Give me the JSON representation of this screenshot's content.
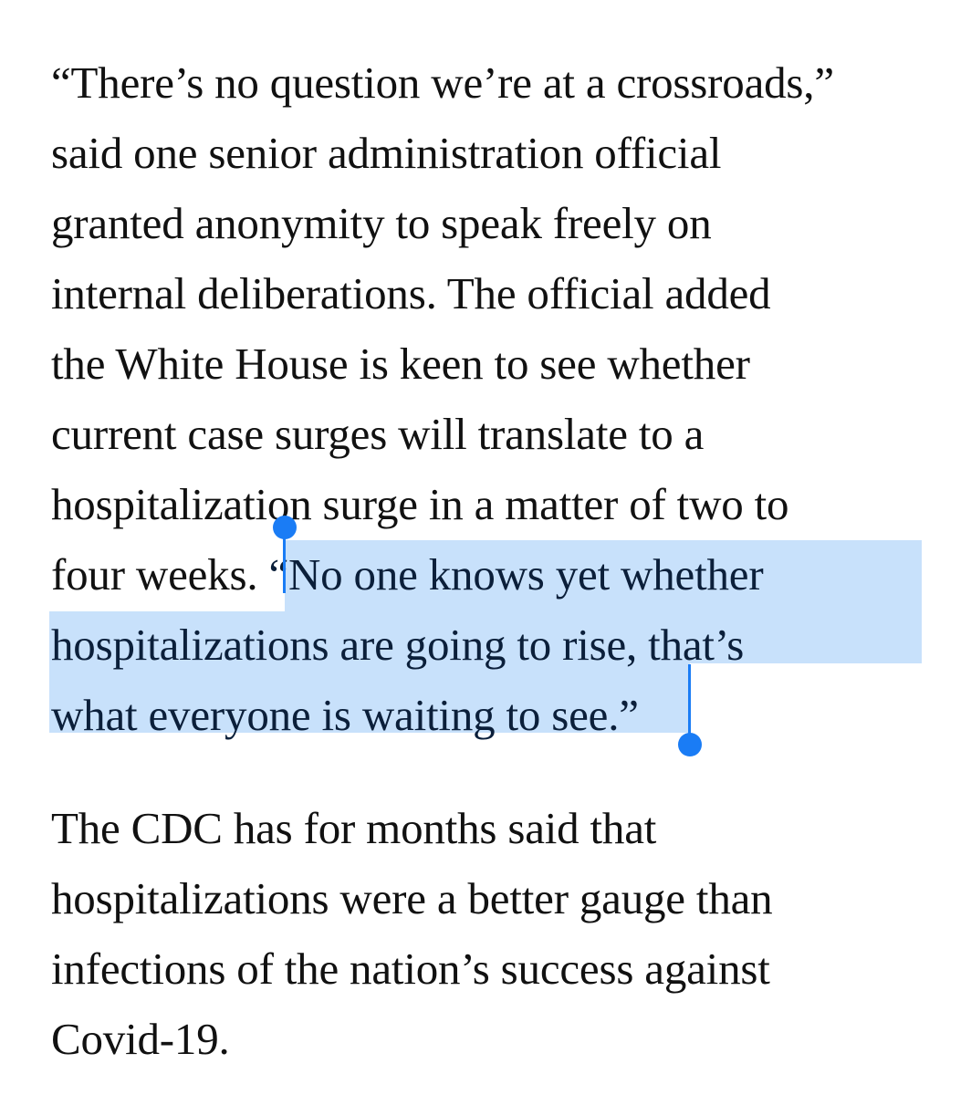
{
  "article": {
    "paragraph1": {
      "lines": [
        "“There’s no question we’re at a crossroads,”",
        "said one senior administration official",
        "granted anonymity to speak freely on",
        "internal deliberations. The official added",
        "the White House is keen to see whether",
        "current case surges will translate to a",
        "hospitalization surge in a matter of two to"
      ],
      "line8_unselected": "four weeks. ",
      "line8_selected": "“No one knows yet whether",
      "line9_selected": "hospitalizations are going to rise, that’s",
      "line10_selected": "what everyone is waiting to see.”"
    },
    "paragraph2": {
      "lines": [
        "The CDC has for months said that",
        "hospitalizations were a better gauge than",
        "infections of the nation’s success against",
        "Covid-19."
      ]
    }
  },
  "colors": {
    "selection_highlight": "#c8e1fb",
    "selection_handle": "#1a7cf5",
    "text": "#111111"
  }
}
